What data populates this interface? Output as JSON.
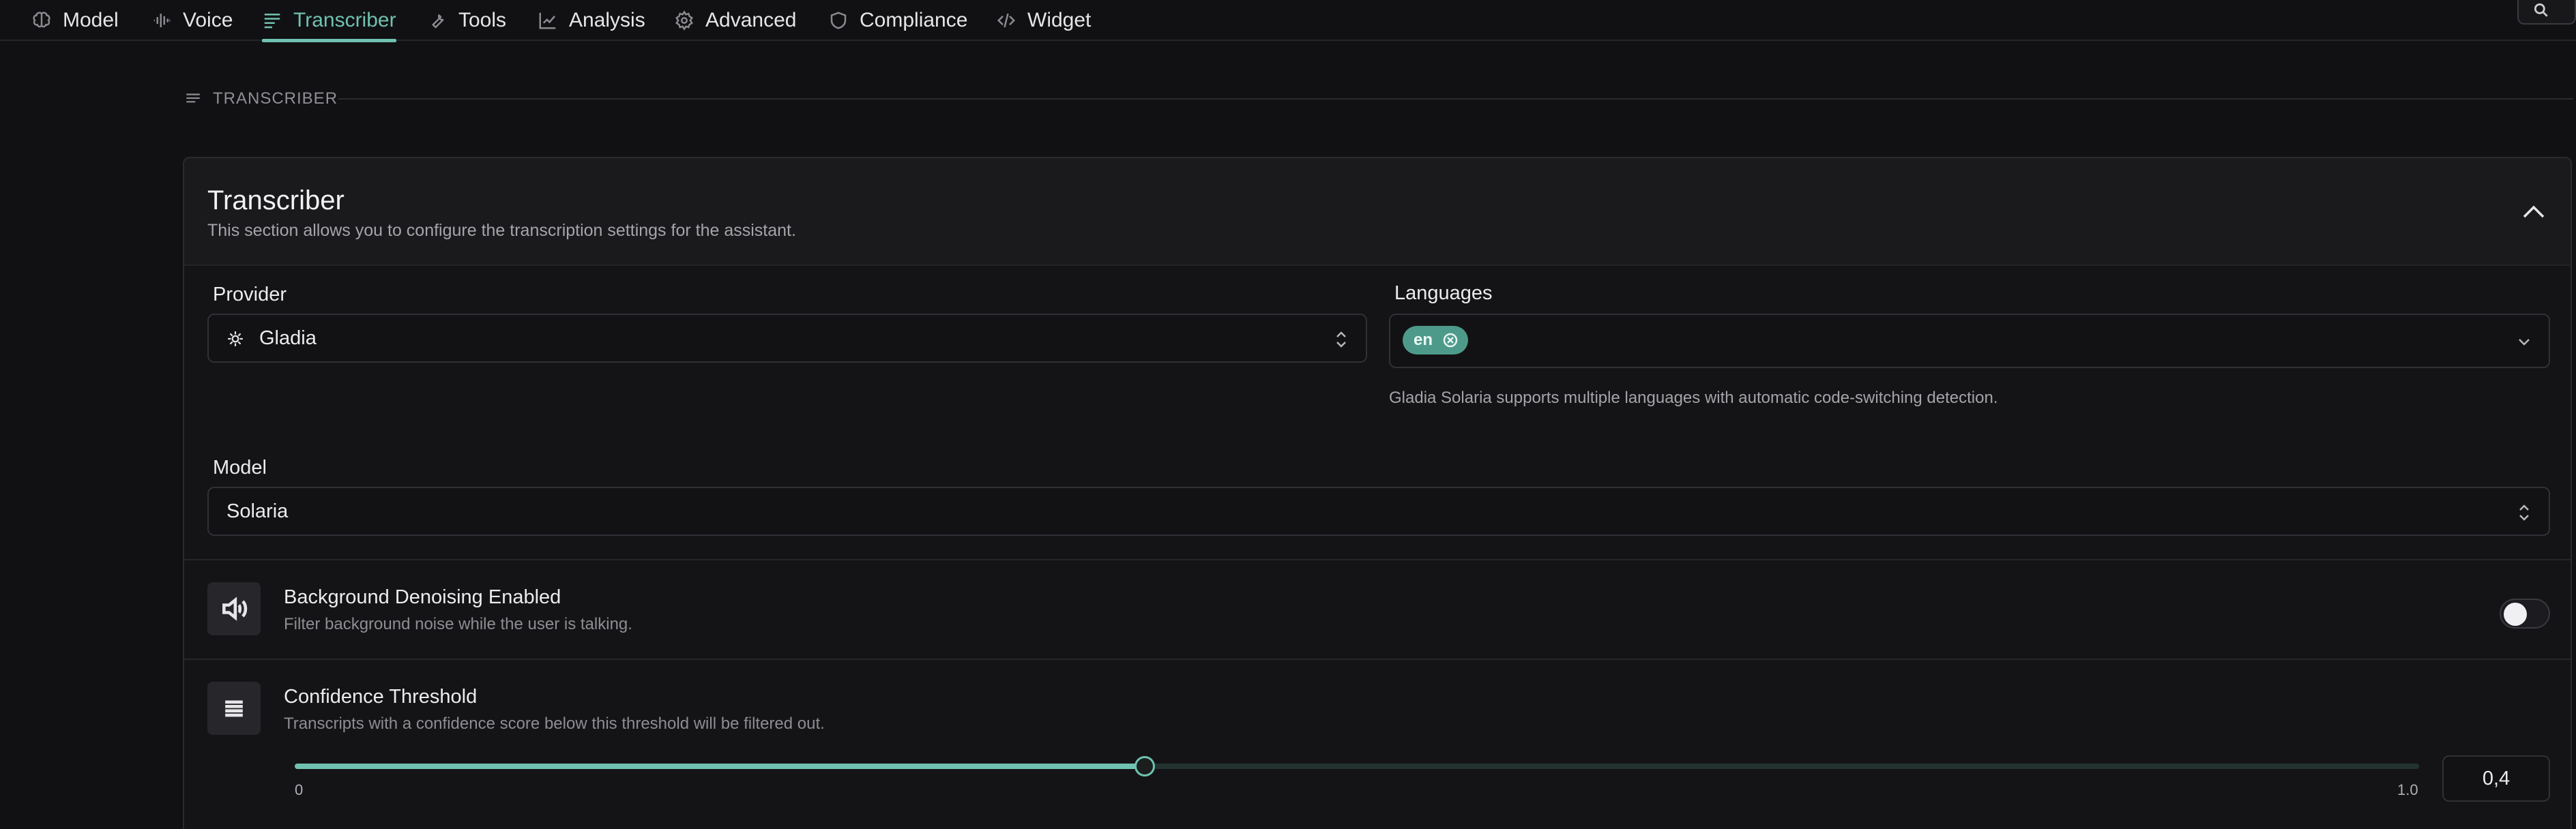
{
  "tabs": [
    {
      "label": "Model",
      "icon": "brain-icon"
    },
    {
      "label": "Voice",
      "icon": "waveform-icon"
    },
    {
      "label": "Transcriber",
      "icon": "text-lines-icon",
      "active": true
    },
    {
      "label": "Tools",
      "icon": "wrench-icon"
    },
    {
      "label": "Analysis",
      "icon": "chart-line-icon"
    },
    {
      "label": "Advanced",
      "icon": "gear-icon"
    },
    {
      "label": "Compliance",
      "icon": "shield-icon"
    },
    {
      "label": "Widget",
      "icon": "code-icon"
    }
  ],
  "section": {
    "label": "TRANSCRIBER"
  },
  "card": {
    "title": "Transcriber",
    "description": "This section allows you to configure the transcription settings for the assistant."
  },
  "provider": {
    "label": "Provider",
    "value": "Gladia"
  },
  "languages": {
    "label": "Languages",
    "chips": [
      "en"
    ],
    "help": "Gladia Solaria supports multiple languages with automatic code-switching detection."
  },
  "model": {
    "label": "Model",
    "value": "Solaria"
  },
  "denoising": {
    "title": "Background Denoising Enabled",
    "subtitle": "Filter background noise while the user is talking.",
    "enabled": false
  },
  "confidence": {
    "title": "Confidence Threshold",
    "subtitle": "Transcripts with a confidence score below this threshold will be filtered out.",
    "min_label": "0",
    "max_label": "1.0",
    "value": 0.4,
    "value_display": "0,4"
  },
  "colors": {
    "accent": "#6fc2b0",
    "chip": "#4e9a8a",
    "background": "#111113"
  }
}
